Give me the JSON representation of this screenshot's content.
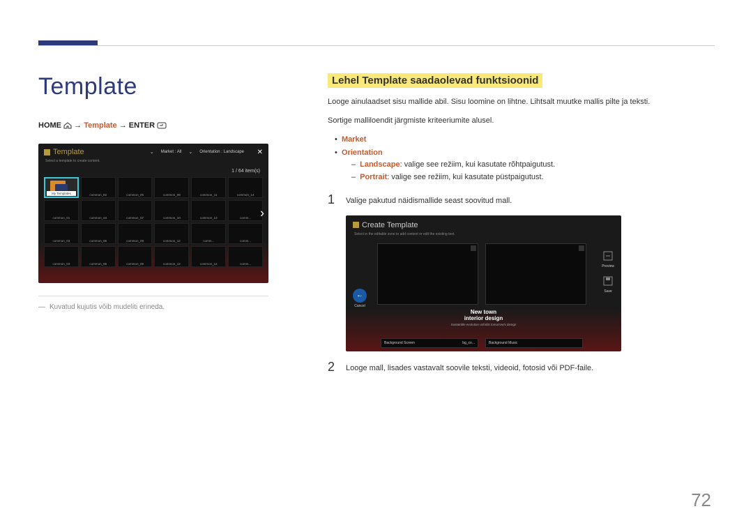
{
  "page_number": "72",
  "left": {
    "heading": "Template",
    "breadcrumb": {
      "home": "HOME",
      "arrow": "→",
      "template": "Template",
      "enter": "ENTER"
    },
    "screenshot": {
      "title": "Template",
      "subtitle": "Select a template to create content.",
      "filter_market_label": "Market :",
      "filter_market_value": "All",
      "filter_orient_label": "Orientation :",
      "filter_orient_value": "Landscape",
      "count": "1 / 64 item(s)",
      "first_cell": "My Templates",
      "cells_row1": [
        "common_02",
        "common_05",
        "common_08",
        "common_11",
        "common_14"
      ],
      "cells_row2": [
        "common_01",
        "common_04",
        "common_07",
        "common_10",
        "common_13",
        "comm..."
      ],
      "cells_row3": [
        "common_03",
        "common_06",
        "common_09",
        "common_12",
        "comm...",
        "comm..."
      ],
      "cells_row4": [
        "common_03",
        "common_06",
        "common_09",
        "common_12",
        "common_14",
        "comm..."
      ]
    },
    "caption": "Kuvatud kujutis võib mudeliti erineda."
  },
  "right": {
    "heading": "Lehel Template saadaolevad funktsioonid",
    "p1": "Looge ainulaadset sisu mallide abil. Sisu loomine on lihtne. Lihtsalt muutke mallis pilte ja teksti.",
    "p2": "Sortige malliloendit järgmiste kriteeriumite alusel.",
    "bullets": {
      "market": "Market",
      "orientation": "Orientation",
      "landscape_label": "Landscape",
      "landscape_text": ": valige see režiim, kui kasutate rõhtpaigutust.",
      "portrait_label": "Portrait",
      "portrait_text": ": valige see režiim, kui kasutate püstpaigutust."
    },
    "step1_num": "1",
    "step1_text": "Valige pakutud näidismallide seast soovitud mall.",
    "screenshot2": {
      "title": "Create Template",
      "subtitle": "Select in the editable zone to add content or edit the existing text.",
      "cancel": "Cancel",
      "preview": "Preview",
      "save": "Save",
      "line1": "New  town",
      "line2": "interior design",
      "line3": "Sustainble evolution unfolds tomorrow's design",
      "tab1_label": "Background Screen",
      "tab1_value": "bg_co...",
      "tab2_label": "Background Music"
    },
    "step2_num": "2",
    "step2_text": "Looge mall, lisades vastavalt soovile teksti, videoid, fotosid või PDF-faile."
  }
}
